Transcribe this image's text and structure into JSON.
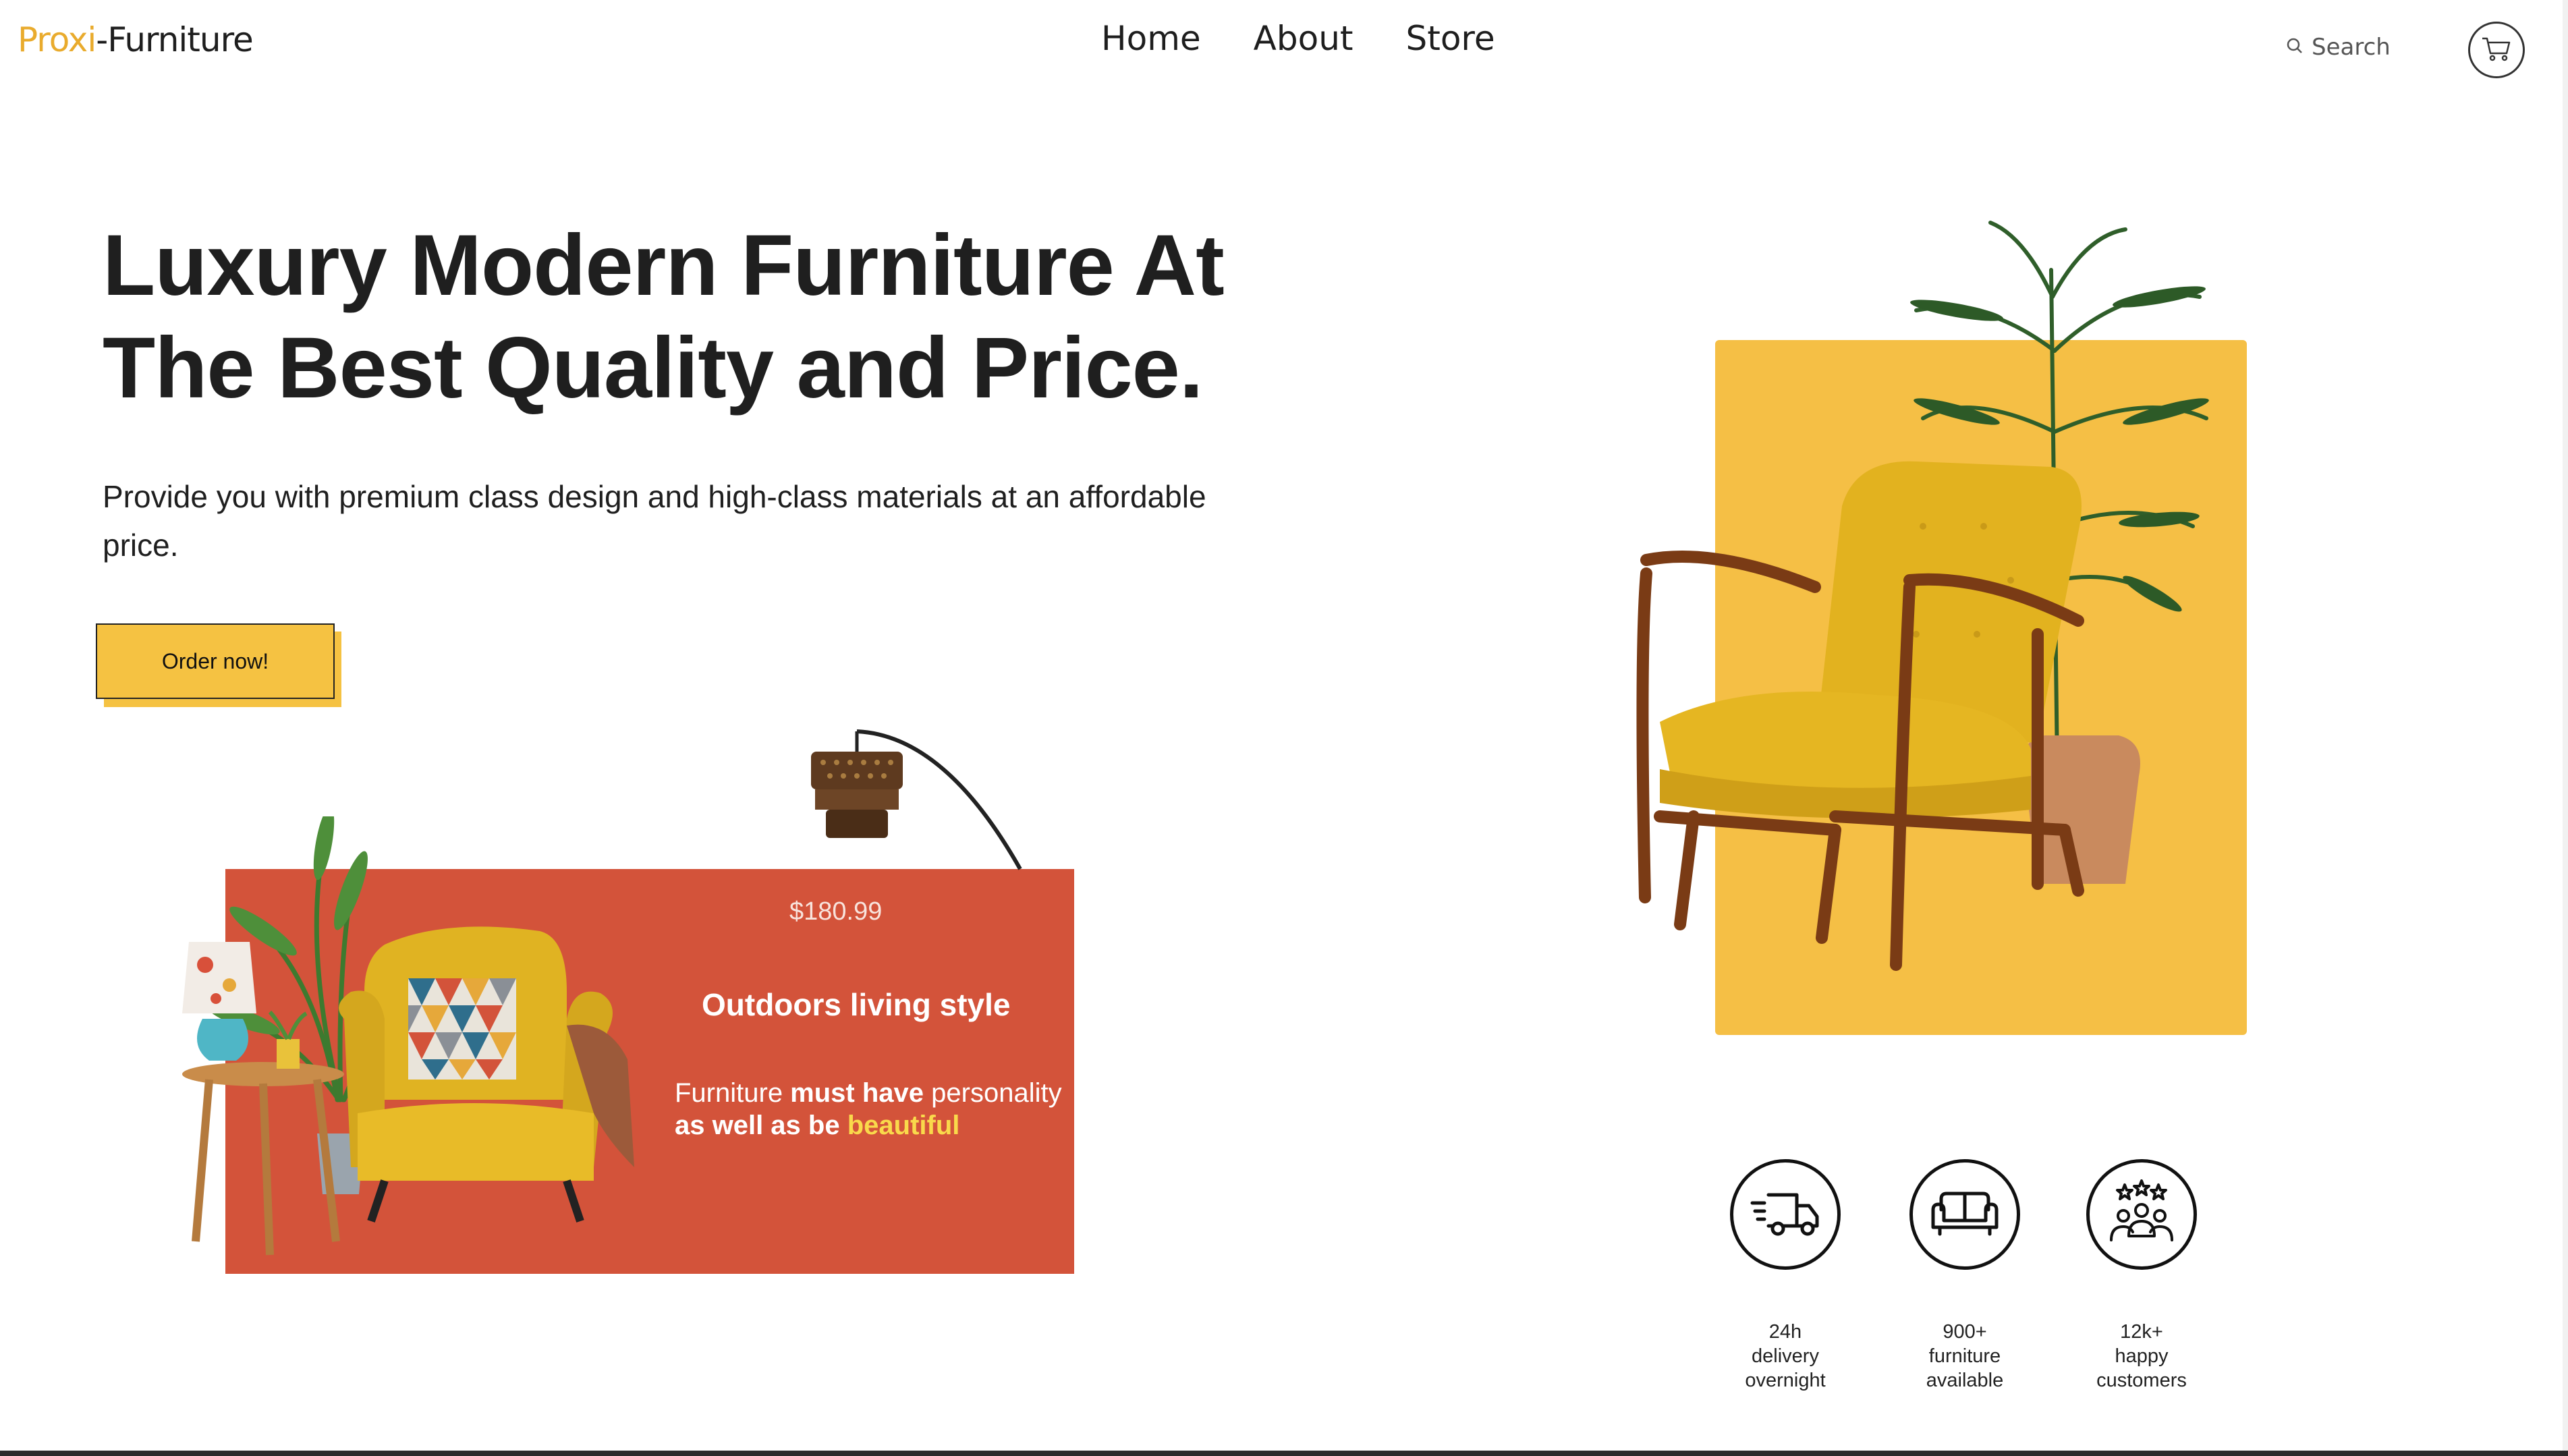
{
  "brand": {
    "accent_part": "Proxi",
    "rest_part": "-Furniture"
  },
  "nav": {
    "home": "Home",
    "about": "About",
    "store": "Store"
  },
  "search": {
    "placeholder": "Search"
  },
  "hero": {
    "title_line1": "Luxury Modern Furniture At",
    "title_line2": "The Best Quality and Price.",
    "subtitle_line1": "Provide you with premium class design and high-class materials at an affordable",
    "subtitle_line2": "price.",
    "cta_label": "Order now!"
  },
  "promo": {
    "price": "$180.99",
    "title": "Outdoors living style",
    "text_1": "Furniture ",
    "text_2": "must have",
    "text_3": " personality",
    "text_4": "as well as be ",
    "text_5": "beautiful"
  },
  "stats": [
    {
      "line1": "24h",
      "line2": "delivery",
      "line3": "overnight",
      "icon": "delivery-truck-icon"
    },
    {
      "line1": "900+",
      "line2": "furniture",
      "line3": "available",
      "icon": "sofa-icon"
    },
    {
      "line1": "12k+",
      "line2": "happy",
      "line3": "customers",
      "icon": "happy-customers-icon"
    }
  ],
  "colors": {
    "accent": "#e9ab2d",
    "button": "#f5c242",
    "promo_bg": "#d3533a",
    "panel_bg": "#f5bf45",
    "highlight": "#f9d94b"
  }
}
